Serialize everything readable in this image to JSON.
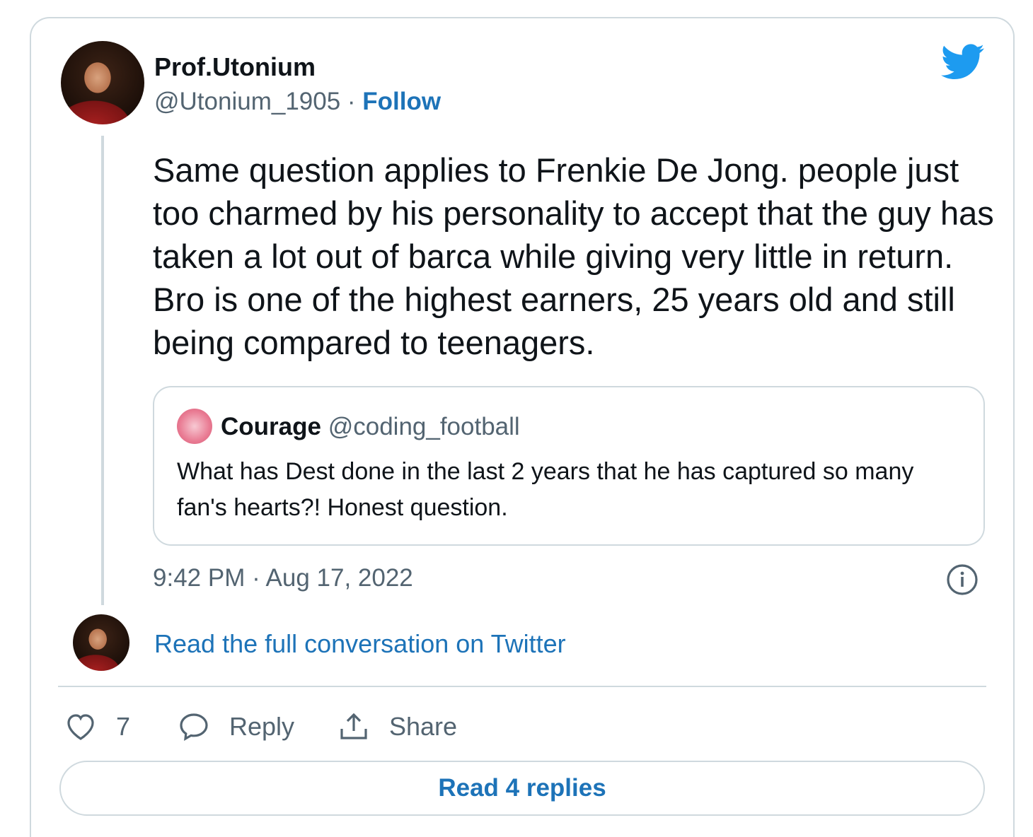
{
  "author": {
    "display_name": "Prof.Utonium",
    "handle": "@Utonium_1905",
    "separator": " · ",
    "follow_label": "Follow"
  },
  "tweet": {
    "text": "Same question applies to Frenkie De Jong. people just too charmed by his personality to accept that the guy has taken a lot out of barca while giving very little in return. Bro is one of the highest earners, 25 years old and still being compared to teenagers.",
    "timestamp": "9:42 PM · Aug 17, 2022"
  },
  "quoted_tweet": {
    "display_name": "Courage",
    "handle": "@coding_football",
    "text": "What has Dest done in the last 2 years that he has captured so many fan's hearts?! Honest question."
  },
  "links": {
    "read_full": "Read the full conversation on Twitter",
    "read_replies": "Read 4 replies"
  },
  "actions": {
    "like_count": "7",
    "reply_label": "Reply",
    "share_label": "Share"
  },
  "icons": {
    "brand": "twitter-bird-icon",
    "info": "info-icon",
    "like": "heart-icon",
    "reply": "speech-bubble-icon",
    "share": "share-upload-icon"
  },
  "colors": {
    "brand_blue": "#1d9bf0",
    "link_blue": "#1d73b8",
    "secondary_text": "#536471",
    "border": "#cfd9de"
  }
}
